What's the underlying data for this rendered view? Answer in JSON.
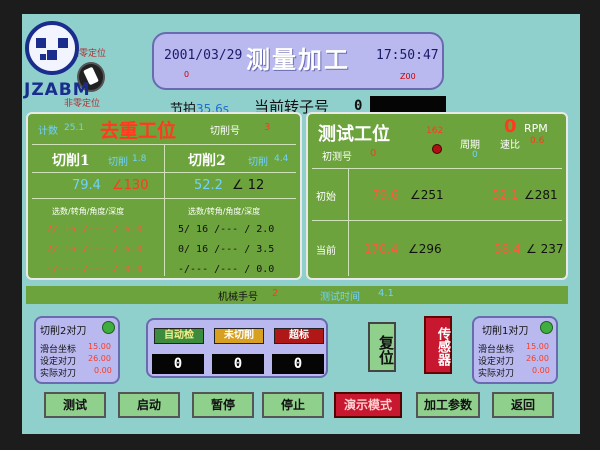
{
  "logo": {
    "text": "JZABM",
    "knob_top": "归零定位",
    "knob_bottom": "非零定位"
  },
  "header": {
    "date": "2001/03/29",
    "title": "测量加工",
    "time": "17:50:47",
    "date_sub": "0",
    "time_sub": "Z00"
  },
  "info": {
    "beat_label": "节拍",
    "beat_value": "35.6s",
    "rotor_label": "当前转子号",
    "rotor_value": "0"
  },
  "left_panel": {
    "title": "去重工位",
    "count_label": "计数",
    "count_value": "25.1",
    "cut_no_label": "切削号",
    "cut_no_value": "3",
    "cut1_label": "切削1",
    "cut1_sub_label": "切削",
    "cut1_sub_value": "1.8",
    "cut2_label": "切削2",
    "cut2_sub_label": "切削",
    "cut2_sub_value": "4.4",
    "val1": "79.4",
    "ang1": "∠130",
    "val2": "52.2",
    "ang2": "∠ 12",
    "col_head1": "选数/转角/角度/深度",
    "col_head2": "选数/转角/角度/深度",
    "rows_left": [
      "2/ 16 /--- / 6.0",
      "2/ 16 /--- / 6.0",
      "-/--- /--- / 0.0"
    ],
    "rows_right": [
      "5/ 16 /--- / 2.0",
      "0/ 16 /--- / 3.5",
      "-/--- /--- / 0.0"
    ]
  },
  "right_panel": {
    "title": "测试工位",
    "led_value": "162",
    "rpm_value": "0",
    "rpm_unit": "RPM",
    "initial_label": "初测号",
    "initial_value": "0",
    "cycle_label": "周期",
    "cycle_value": "0",
    "speed_label": "速比",
    "speed_value": "0.6",
    "row1_label": "初始",
    "row1_v1": "79.6",
    "row1_a1": "∠251",
    "row1_v2": "52.1",
    "row1_a2": "∠281",
    "row2_label": "当前",
    "row2_v1": "170.4",
    "row2_a1": "∠296",
    "row2_v2": "58.4",
    "row2_a2": "∠ 237"
  },
  "strip": {
    "machine_label": "机械手号",
    "machine_value": "2",
    "test_label": "测试时间",
    "test_value": "4.1"
  },
  "left_box": {
    "title": "切削2对刀",
    "r1_label": "滑台坐标",
    "r1_value": "15.00",
    "r2_label": "设定对刀",
    "r2_value": "26.00",
    "r3_label": "实际对刀",
    "r3_value": "0.00"
  },
  "right_box": {
    "title": "切削1对刀",
    "r1_label": "滑台坐标",
    "r1_value": "15.00",
    "r2_label": "设定对刀",
    "r2_value": "26.00",
    "r3_label": "实际对刀",
    "r3_value": "0.00"
  },
  "center": {
    "btn1": "自动检",
    "btn2": "未切削",
    "btn3": "超标",
    "disp1": "0",
    "disp2": "0",
    "disp3": "0"
  },
  "vertical": {
    "reset": "复位",
    "sensor": "传感器"
  },
  "footer": [
    "测试",
    "启动",
    "暂停",
    "停止",
    "演示模式",
    "加工参数",
    "返回"
  ],
  "colors": {
    "panel_green": "#6da33d",
    "screen_teal": "#8fd0cd",
    "title_lilac": "#b9b9ef",
    "accent_red": "#ff3a1f"
  }
}
